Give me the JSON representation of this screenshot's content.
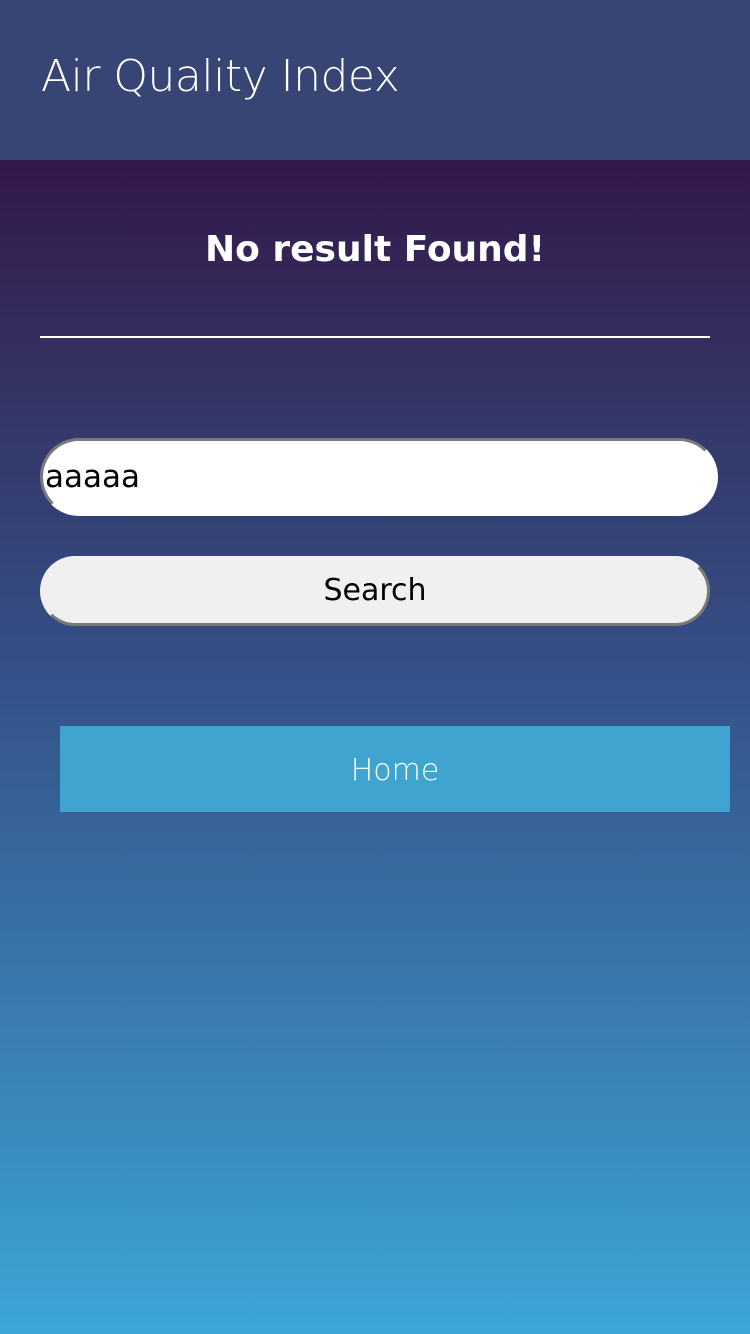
{
  "header": {
    "title": "Air Quality Index"
  },
  "main": {
    "message": "No result Found!",
    "search": {
      "value": "aaaaa",
      "placeholder": ""
    },
    "search_button_label": "Search",
    "home_button_label": "Home"
  },
  "colors": {
    "header_bg": "#364574",
    "gradient_top": "#33184a",
    "gradient_bottom": "#3ba6d6",
    "home_button_bg": "#40a4d0",
    "search_button_bg": "#f0f0f0",
    "text_light": "#ffffff"
  }
}
